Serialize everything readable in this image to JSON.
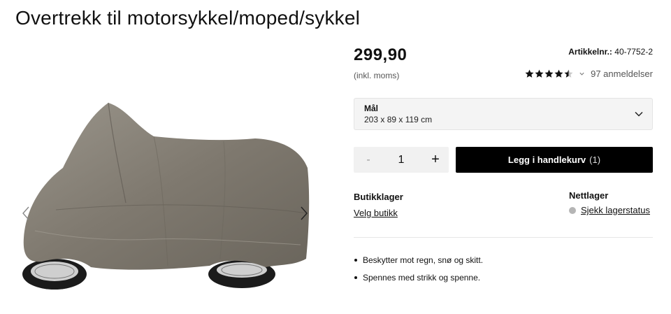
{
  "product": {
    "title": "Overtrekk til motorsykkel/moped/sykkel",
    "price": "299,90",
    "vat_note": "(inkl. moms)",
    "article_label": "Artikkelnr.:",
    "article_number": "40-7752-2",
    "rating": 4.5,
    "rating_max": 5,
    "reviews_text": "97 anmeldelser"
  },
  "gallery": {
    "image_icon": "motorcycle-cover-image",
    "prev_icon": "chevron-left-icon",
    "next_icon": "chevron-right-icon"
  },
  "size_select": {
    "label": "Mål",
    "value": "203 x 89 x 119 cm",
    "icon": "chevron-down-icon"
  },
  "quantity": {
    "minus": "-",
    "value": "1",
    "plus": "+"
  },
  "cart": {
    "label": "Legg i handlekurv",
    "count": "(1)"
  },
  "store_stock": {
    "heading": "Butikklager",
    "link": "Velg butikk"
  },
  "online_stock": {
    "heading": "Nettlager",
    "link": "Sjekk lagerstatus",
    "status_color": "#b5b5b5"
  },
  "features": [
    "Beskytter mot regn, snø og skitt.",
    "Spennes med strikk og spenne."
  ],
  "colors": {
    "button_bg": "#000000",
    "select_bg": "#f4f4f4",
    "cover_fabric": "#8a8478"
  }
}
